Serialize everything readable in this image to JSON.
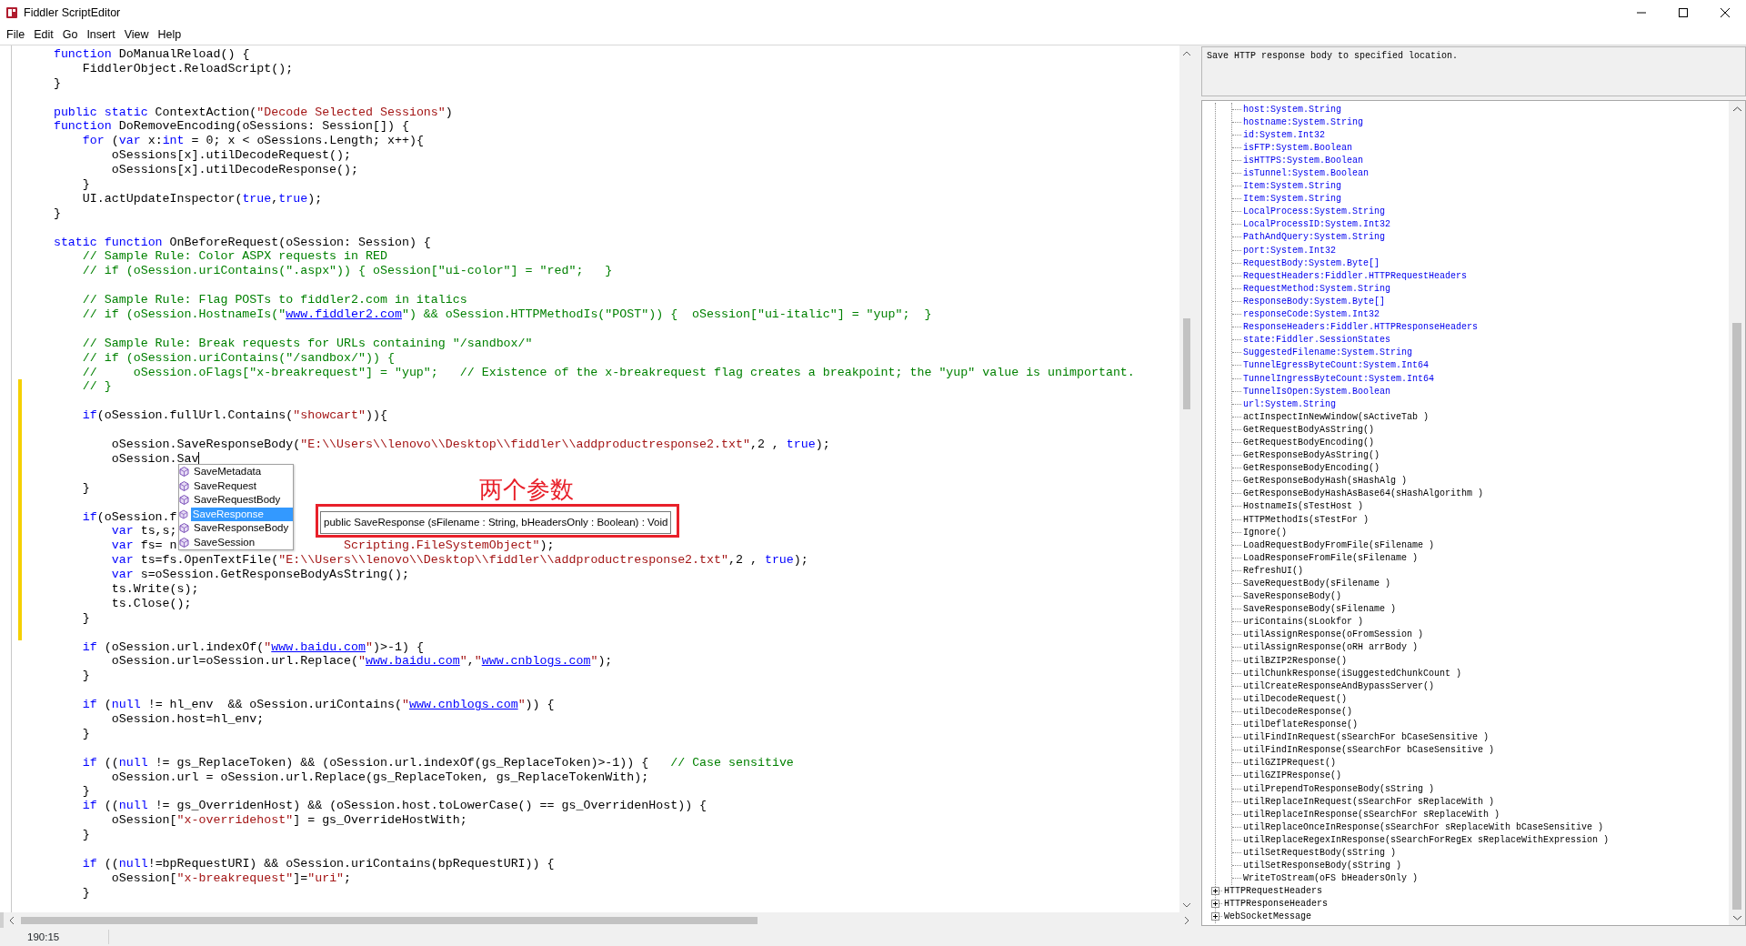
{
  "window": {
    "title": "Fiddler ScriptEditor"
  },
  "menu": [
    "File",
    "Edit",
    "Go",
    "Insert",
    "View",
    "Help"
  ],
  "editor": {
    "lines": [
      {
        "changed": false,
        "segments": [
          {
            "kind": "tab"
          },
          {
            "kind": "kw",
            "text": "function"
          },
          " DoManualReload() {"
        ]
      },
      {
        "changed": false,
        "segments": [
          {
            "kind": "tab"
          },
          {
            "kind": "tab"
          },
          "FiddlerObject.ReloadScript();"
        ]
      },
      {
        "changed": false,
        "segments": [
          {
            "kind": "tab"
          },
          "}"
        ]
      },
      {
        "changed": false
      },
      {
        "changed": false,
        "segments": [
          {
            "kind": "tab"
          },
          {
            "kind": "kw",
            "text": "public static"
          },
          " ContextAction(",
          {
            "kind": "str",
            "text": "\"Decode Selected Sessions\""
          },
          ")"
        ]
      },
      {
        "changed": false,
        "segments": [
          {
            "kind": "tab"
          },
          {
            "kind": "kw",
            "text": "function"
          },
          " DoRemoveEncoding(oSessions: Session[]) {"
        ]
      },
      {
        "changed": false,
        "segments": [
          {
            "kind": "tab"
          },
          {
            "kind": "tab"
          },
          {
            "kind": "kw",
            "text": "for"
          },
          " (",
          {
            "kind": "kw",
            "text": "var"
          },
          " x:",
          {
            "kind": "kw",
            "text": "int"
          },
          " = 0; x < oSessions.Length; x++){"
        ]
      },
      {
        "changed": false,
        "segments": [
          {
            "kind": "tab"
          },
          {
            "kind": "tab"
          },
          {
            "kind": "tab"
          },
          "oSessions[x].utilDecodeRequest();"
        ]
      },
      {
        "changed": false,
        "segments": [
          {
            "kind": "tab"
          },
          {
            "kind": "tab"
          },
          {
            "kind": "tab"
          },
          "oSessions[x].utilDecodeResponse();"
        ]
      },
      {
        "changed": false,
        "segments": [
          {
            "kind": "tab"
          },
          {
            "kind": "tab"
          },
          "}"
        ]
      },
      {
        "changed": false,
        "segments": [
          {
            "kind": "tab"
          },
          {
            "kind": "tab"
          },
          "UI.actUpdateInspector(",
          {
            "kind": "kw",
            "text": "true"
          },
          ",",
          {
            "kind": "kw",
            "text": "true"
          },
          ");"
        ]
      },
      {
        "changed": false,
        "segments": [
          {
            "kind": "tab"
          },
          "}"
        ]
      },
      {
        "changed": false
      },
      {
        "changed": false,
        "segments": [
          {
            "kind": "tab"
          },
          {
            "kind": "kw",
            "text": "static function"
          },
          " OnBeforeRequest(oSession: Session) {"
        ]
      },
      {
        "changed": false,
        "segments": [
          {
            "kind": "tab"
          },
          {
            "kind": "tab"
          },
          {
            "kind": "com",
            "text": "// Sample Rule: Color ASPX requests in RED"
          }
        ]
      },
      {
        "changed": false,
        "segments": [
          {
            "kind": "tab"
          },
          {
            "kind": "tab"
          },
          {
            "kind": "com",
            "text": "// if (oSession.uriContains(\".aspx\")) { oSession[\"ui-color\"] = \"red\";   }"
          }
        ]
      },
      {
        "changed": false
      },
      {
        "changed": false,
        "segments": [
          {
            "kind": "tab"
          },
          {
            "kind": "tab"
          },
          {
            "kind": "com",
            "text": "// Sample Rule: Flag POSTs to fiddler2.com in italics"
          }
        ]
      },
      {
        "changed": false,
        "segments": [
          {
            "kind": "tab"
          },
          {
            "kind": "tab"
          },
          {
            "kind": "com",
            "text": "// if (oSession.HostnameIs(\""
          },
          {
            "kind": "link",
            "text": "www.fiddler2.com"
          },
          {
            "kind": "com",
            "text": "\") && oSession.HTTPMethodIs(\"POST\")) {  oSession[\"ui-italic\"] = \"yup\";  }"
          }
        ]
      },
      {
        "changed": false
      },
      {
        "changed": false,
        "segments": [
          {
            "kind": "tab"
          },
          {
            "kind": "tab"
          },
          {
            "kind": "com",
            "text": "// Sample Rule: Break requests for URLs containing \"/sandbox/\""
          }
        ]
      },
      {
        "changed": false,
        "segments": [
          {
            "kind": "tab"
          },
          {
            "kind": "tab"
          },
          {
            "kind": "com",
            "text": "// if (oSession.uriContains(\"/sandbox/\")) {"
          }
        ]
      },
      {
        "changed": false,
        "segments": [
          {
            "kind": "tab"
          },
          {
            "kind": "tab"
          },
          {
            "kind": "com",
            "text": "//     oSession.oFlags[\"x-breakrequest\"] = \"yup\";   // Existence of the x-breakrequest flag creates a breakpoint; the \"yup\" value is unimportant."
          }
        ]
      },
      {
        "changed": true,
        "segments": [
          {
            "kind": "tab"
          },
          {
            "kind": "tab"
          },
          {
            "kind": "com",
            "text": "// }"
          }
        ]
      },
      {
        "changed": true
      },
      {
        "changed": true,
        "segments": [
          {
            "kind": "tab"
          },
          {
            "kind": "tab"
          },
          {
            "kind": "kw",
            "text": "if"
          },
          "(oSession.fullUrl.Contains(",
          {
            "kind": "str",
            "text": "\"showcart\""
          },
          ")){"
        ]
      },
      {
        "changed": true
      },
      {
        "changed": true,
        "segments": [
          {
            "kind": "tab"
          },
          {
            "kind": "tab"
          },
          {
            "kind": "tab"
          },
          "oSession.SaveResponseBody(",
          {
            "kind": "str",
            "text": "\"E:\\\\Users\\\\lenovo\\\\Desktop\\\\fiddler\\\\addproductresponse2.txt\""
          },
          ",2 , ",
          {
            "kind": "kw",
            "text": "true"
          },
          ");"
        ]
      },
      {
        "changed": true,
        "segments": [
          {
            "kind": "tab"
          },
          {
            "kind": "tab"
          },
          {
            "kind": "tab"
          },
          "oSession.Sav",
          {
            "kind": "caret"
          }
        ]
      },
      {
        "changed": true
      },
      {
        "changed": true,
        "segments": [
          {
            "kind": "tab"
          },
          {
            "kind": "tab"
          },
          "}"
        ]
      },
      {
        "changed": true
      },
      {
        "changed": true,
        "segments": [
          {
            "kind": "tab"
          },
          {
            "kind": "tab"
          },
          {
            "kind": "kw",
            "text": "if"
          },
          "(oSession.f"
        ]
      },
      {
        "changed": true,
        "segments": [
          {
            "kind": "tab"
          },
          {
            "kind": "tab"
          },
          {
            "kind": "tab"
          },
          {
            "kind": "kw",
            "text": "var"
          },
          " ts,s;"
        ]
      },
      {
        "changed": true,
        "segments": [
          {
            "kind": "tab"
          },
          {
            "kind": "tab"
          },
          {
            "kind": "tab"
          },
          {
            "kind": "kw",
            "text": "var"
          },
          " fs= n",
          {
            "kind": "gap"
          },
          {
            "kind": "str",
            "text": "Scripting.FileSystemObject\""
          },
          ");"
        ]
      },
      {
        "changed": true,
        "segments": [
          {
            "kind": "tab"
          },
          {
            "kind": "tab"
          },
          {
            "kind": "tab"
          },
          {
            "kind": "kw",
            "text": "var"
          },
          " ts=fs.OpenTextFile(",
          {
            "kind": "str",
            "text": "\"E:\\\\Users\\\\lenovo\\\\Desktop\\\\fiddler\\\\addproductresponse2.txt\""
          },
          ",2 , ",
          {
            "kind": "kw",
            "text": "true"
          },
          ");"
        ]
      },
      {
        "changed": true,
        "segments": [
          {
            "kind": "tab"
          },
          {
            "kind": "tab"
          },
          {
            "kind": "tab"
          },
          {
            "kind": "kw",
            "text": "var"
          },
          " s=oSession.GetResponseBodyAsString();"
        ]
      },
      {
        "changed": true,
        "segments": [
          {
            "kind": "tab"
          },
          {
            "kind": "tab"
          },
          {
            "kind": "tab"
          },
          "ts.Write(s);"
        ]
      },
      {
        "changed": true,
        "segments": [
          {
            "kind": "tab"
          },
          {
            "kind": "tab"
          },
          {
            "kind": "tab"
          },
          "ts.Close();"
        ]
      },
      {
        "changed": true,
        "segments": [
          {
            "kind": "tab"
          },
          {
            "kind": "tab"
          },
          "}"
        ]
      },
      {
        "changed": true
      },
      {
        "changed": false,
        "segments": [
          {
            "kind": "tab"
          },
          {
            "kind": "tab"
          },
          {
            "kind": "kw",
            "text": "if"
          },
          " (oSession.url.indexOf(",
          {
            "kind": "str",
            "text": "\""
          },
          {
            "kind": "link",
            "text": "www.baidu.com"
          },
          {
            "kind": "str",
            "text": "\""
          },
          ")>-1) {"
        ]
      },
      {
        "changed": false,
        "segments": [
          {
            "kind": "tab"
          },
          {
            "kind": "tab"
          },
          {
            "kind": "tab"
          },
          "oSession.url=oSession.url.Replace(",
          {
            "kind": "str",
            "text": "\""
          },
          {
            "kind": "link",
            "text": "www.baidu.com"
          },
          {
            "kind": "str",
            "text": "\""
          },
          ",",
          {
            "kind": "str",
            "text": "\""
          },
          {
            "kind": "link",
            "text": "www.cnblogs.com"
          },
          {
            "kind": "str",
            "text": "\""
          },
          ");"
        ]
      },
      {
        "changed": false,
        "segments": [
          {
            "kind": "tab"
          },
          {
            "kind": "tab"
          },
          "}"
        ]
      },
      {
        "changed": false
      },
      {
        "changed": false,
        "segments": [
          {
            "kind": "tab"
          },
          {
            "kind": "tab"
          },
          {
            "kind": "kw",
            "text": "if"
          },
          " (",
          {
            "kind": "kw",
            "text": "null"
          },
          " != hl_env  && oSession.uriContains(",
          {
            "kind": "str",
            "text": "\""
          },
          {
            "kind": "link",
            "text": "www.cnblogs.com"
          },
          {
            "kind": "str",
            "text": "\""
          },
          ")) {"
        ]
      },
      {
        "changed": false,
        "segments": [
          {
            "kind": "tab"
          },
          {
            "kind": "tab"
          },
          {
            "kind": "tab"
          },
          "oSession.host=hl_env;"
        ]
      },
      {
        "changed": false,
        "segments": [
          {
            "kind": "tab"
          },
          {
            "kind": "tab"
          },
          "}"
        ]
      },
      {
        "changed": false
      },
      {
        "changed": false,
        "segments": [
          {
            "kind": "tab"
          },
          {
            "kind": "tab"
          },
          {
            "kind": "kw",
            "text": "if"
          },
          " ((",
          {
            "kind": "kw",
            "text": "null"
          },
          " != gs_ReplaceToken) && (oSession.url.indexOf(gs_ReplaceToken)>-1)) {   ",
          {
            "kind": "com",
            "text": "// Case sensitive"
          }
        ]
      },
      {
        "changed": false,
        "segments": [
          {
            "kind": "tab"
          },
          {
            "kind": "tab"
          },
          {
            "kind": "tab"
          },
          "oSession.url = oSession.url.Replace(gs_ReplaceToken, gs_ReplaceTokenWith);"
        ]
      },
      {
        "changed": false,
        "segments": [
          {
            "kind": "tab"
          },
          {
            "kind": "tab"
          },
          "}"
        ]
      },
      {
        "changed": false,
        "segments": [
          {
            "kind": "tab"
          },
          {
            "kind": "tab"
          },
          {
            "kind": "kw",
            "text": "if"
          },
          " ((",
          {
            "kind": "kw",
            "text": "null"
          },
          " != gs_OverridenHost) && (oSession.host.toLowerCase() == gs_OverridenHost)) {"
        ]
      },
      {
        "changed": false,
        "segments": [
          {
            "kind": "tab"
          },
          {
            "kind": "tab"
          },
          {
            "kind": "tab"
          },
          "oSession[",
          {
            "kind": "str",
            "text": "\"x-overridehost\""
          },
          "] = gs_OverrideHostWith;"
        ]
      },
      {
        "changed": false,
        "segments": [
          {
            "kind": "tab"
          },
          {
            "kind": "tab"
          },
          "}"
        ]
      },
      {
        "changed": false
      },
      {
        "changed": false,
        "segments": [
          {
            "kind": "tab"
          },
          {
            "kind": "tab"
          },
          {
            "kind": "kw",
            "text": "if"
          },
          " ((",
          {
            "kind": "kw",
            "text": "null"
          },
          "!=bpRequestURI) && oSession.uriContains(bpRequestURI)) {"
        ]
      },
      {
        "changed": false,
        "segments": [
          {
            "kind": "tab"
          },
          {
            "kind": "tab"
          },
          {
            "kind": "tab"
          },
          "oSession[",
          {
            "kind": "str",
            "text": "\"x-breakrequest\""
          },
          "]=",
          {
            "kind": "str",
            "text": "\"uri\""
          },
          ";"
        ]
      },
      {
        "changed": false,
        "segments": [
          {
            "kind": "tab"
          },
          {
            "kind": "tab"
          },
          "}"
        ]
      }
    ],
    "autocomplete": {
      "items": [
        {
          "label": "SaveMetadata",
          "selected": false
        },
        {
          "label": "SaveRequest",
          "selected": false
        },
        {
          "label": "SaveRequestBody",
          "selected": false
        },
        {
          "label": "SaveResponse",
          "selected": true
        },
        {
          "label": "SaveResponseBody",
          "selected": false
        },
        {
          "label": "SaveSession",
          "selected": false
        }
      ],
      "tooltip": "public SaveResponse (sFilename : String, bHeadersOnly : Boolean) : Void"
    },
    "annotation": {
      "text": "两个参数"
    }
  },
  "member_panel": {
    "description": "Save HTTP response body to specified location.",
    "tree": [
      {
        "expanded": true,
        "children": [
          {
            "kind": "property",
            "text": "host:System.String"
          },
          {
            "kind": "property",
            "text": "hostname:System.String"
          },
          {
            "kind": "property",
            "text": "id:System.Int32"
          },
          {
            "kind": "property",
            "text": "isFTP:System.Boolean"
          },
          {
            "kind": "property",
            "text": "isHTTPS:System.Boolean"
          },
          {
            "kind": "property",
            "text": "isTunnel:System.Boolean"
          },
          {
            "kind": "property",
            "text": "Item:System.String"
          },
          {
            "kind": "property",
            "text": "Item:System.String"
          },
          {
            "kind": "property",
            "text": "LocalProcess:System.String"
          },
          {
            "kind": "property",
            "text": "LocalProcessID:System.Int32"
          },
          {
            "kind": "property",
            "text": "PathAndQuery:System.String"
          },
          {
            "kind": "property",
            "text": "port:System.Int32"
          },
          {
            "kind": "property",
            "text": "RequestBody:System.Byte[]"
          },
          {
            "kind": "property",
            "text": "RequestHeaders:Fiddler.HTTPRequestHeaders"
          },
          {
            "kind": "property",
            "text": "RequestMethod:System.String"
          },
          {
            "kind": "property",
            "text": "ResponseBody:System.Byte[]"
          },
          {
            "kind": "property",
            "text": "responseCode:System.Int32"
          },
          {
            "kind": "property",
            "text": "ResponseHeaders:Fiddler.HTTPResponseHeaders"
          },
          {
            "kind": "property",
            "text": "state:Fiddler.SessionStates"
          },
          {
            "kind": "property",
            "text": "SuggestedFilename:System.String"
          },
          {
            "kind": "property",
            "text": "TunnelEgressByteCount:System.Int64"
          },
          {
            "kind": "property",
            "text": "TunnelIngressByteCount:System.Int64"
          },
          {
            "kind": "property",
            "text": "TunnelIsOpen:System.Boolean"
          },
          {
            "kind": "property",
            "text": "url:System.String"
          },
          {
            "kind": "method",
            "text": "actInspectInNewWindow(sActiveTab )"
          },
          {
            "kind": "method",
            "text": "GetRequestBodyAsString()"
          },
          {
            "kind": "method",
            "text": "GetRequestBodyEncoding()"
          },
          {
            "kind": "method",
            "text": "GetResponseBodyAsString()"
          },
          {
            "kind": "method",
            "text": "GetResponseBodyEncoding()"
          },
          {
            "kind": "method",
            "text": "GetResponseBodyHash(sHashAlg )"
          },
          {
            "kind": "method",
            "text": "GetResponseBodyHashAsBase64(sHashAlgorithm )"
          },
          {
            "kind": "method",
            "text": "HostnameIs(sTestHost )"
          },
          {
            "kind": "method",
            "text": "HTTPMethodIs(sTestFor )"
          },
          {
            "kind": "method",
            "text": "Ignore()"
          },
          {
            "kind": "method",
            "text": "LoadRequestBodyFromFile(sFilename )"
          },
          {
            "kind": "method",
            "text": "LoadResponseFromFile(sFilename )"
          },
          {
            "kind": "method",
            "text": "RefreshUI()"
          },
          {
            "kind": "method",
            "text": "SaveRequestBody(sFilename )"
          },
          {
            "kind": "method",
            "text": "SaveResponseBody()"
          },
          {
            "kind": "method",
            "text": "SaveResponseBody(sFilename )"
          },
          {
            "kind": "method",
            "text": "uriContains(sLookfor )"
          },
          {
            "kind": "method",
            "text": "utilAssignResponse(oFromSession )"
          },
          {
            "kind": "method",
            "text": "utilAssignResponse(oRH arrBody )"
          },
          {
            "kind": "method",
            "text": "utilBZIP2Response()"
          },
          {
            "kind": "method",
            "text": "utilChunkResponse(iSuggestedChunkCount )"
          },
          {
            "kind": "method",
            "text": "utilCreateResponseAndBypassServer()"
          },
          {
            "kind": "method",
            "text": "utilDecodeRequest()"
          },
          {
            "kind": "method",
            "text": "utilDecodeResponse()"
          },
          {
            "kind": "method",
            "text": "utilDeflateResponse()"
          },
          {
            "kind": "method",
            "text": "utilFindInRequest(sSearchFor bCaseSensitive )"
          },
          {
            "kind": "method",
            "text": "utilFindInResponse(sSearchFor bCaseSensitive )"
          },
          {
            "kind": "method",
            "text": "utilGZIPRequest()"
          },
          {
            "kind": "method",
            "text": "utilGZIPResponse()"
          },
          {
            "kind": "method",
            "text": "utilPrependToResponseBody(sString )"
          },
          {
            "kind": "method",
            "text": "utilReplaceInRequest(sSearchFor sReplaceWith )"
          },
          {
            "kind": "method",
            "text": "utilReplaceInResponse(sSearchFor sReplaceWith )"
          },
          {
            "kind": "method",
            "text": "utilReplaceOnceInResponse(sSearchFor sReplaceWith bCaseSensitive )"
          },
          {
            "kind": "method",
            "text": "utilReplaceRegexInResponse(sSearchForRegEx sReplaceWithExpression )"
          },
          {
            "kind": "method",
            "text": "utilSetRequestBody(sString )"
          },
          {
            "kind": "method",
            "text": "utilSetResponseBody(sString )"
          },
          {
            "kind": "method",
            "text": "WriteToStream(oFS bHeadersOnly )"
          }
        ]
      },
      {
        "label": "HTTPRequestHeaders",
        "expanded": false
      },
      {
        "label": "HTTPResponseHeaders",
        "expanded": false
      },
      {
        "label": "WebSocketMessage",
        "expanded": false
      }
    ]
  },
  "status_bar": {
    "position": "190:15"
  }
}
